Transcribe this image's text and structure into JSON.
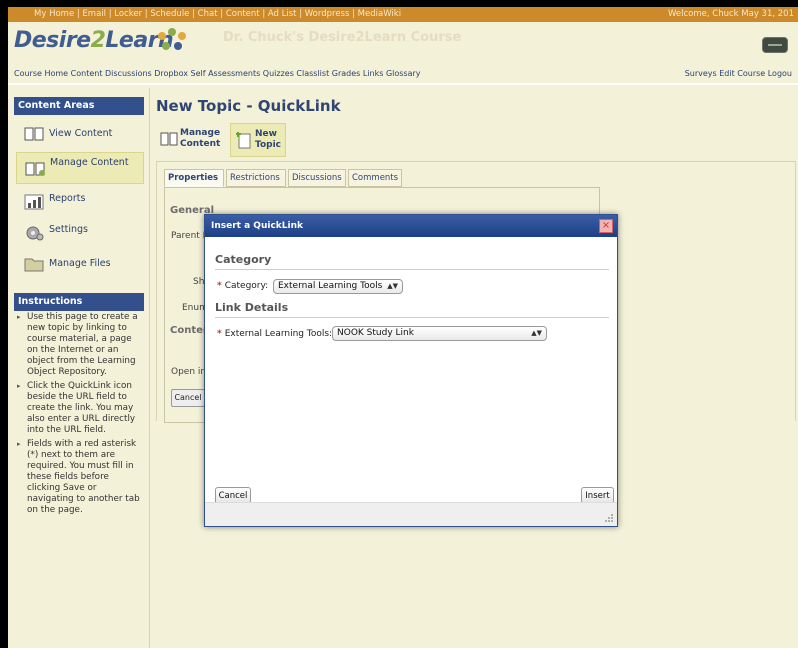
{
  "topbar": {
    "nav": "My Home | Email | Locker | Schedule | Chat | Content | Ad List | Wordpress | MediaWiki",
    "welcome": "Welcome, Chuck  May 31, 201"
  },
  "header": {
    "logo_main": "Desire",
    "logo_two": "2",
    "logo_end": "Learn",
    "course_title": "Dr. Chuck's Desire2Learn Course",
    "course_nav": "Course Home  Content  Discussions  Dropbox  Self Assessments  Quizzes  Classlist  Grades  Links  Glossary",
    "right_nav": "Surveys  Edit Course  Logou"
  },
  "sidebar": {
    "content_areas_title": "Content Areas",
    "items": [
      {
        "label": "View Content",
        "icon": "book-icon"
      },
      {
        "label": "Manage Content",
        "icon": "manage-book-icon"
      },
      {
        "label": "Reports",
        "icon": "chart-icon"
      },
      {
        "label": "Settings",
        "icon": "gear-icon"
      },
      {
        "label": "Manage Files",
        "icon": "folder-icon"
      }
    ],
    "instructions_title": "Instructions",
    "instructions": [
      "Use this page to create a new topic by linking to course material, a page on the Internet or an object from the Learning Object Repository.",
      "Click the QuickLink icon beside the URL field to create the link. You may also enter a URL directly into the URL field.",
      "Fields with a red asterisk (*) next to them are required. You must fill in these fields before clicking Save or navigating to another tab on the page."
    ]
  },
  "main": {
    "title": "New Topic - QuickLink",
    "toolbar": {
      "manage_line1": "Manage",
      "manage_line2": "Content",
      "new_line1": "New",
      "new_line2": "Topic"
    },
    "tabs": [
      "Properties",
      "Restrictions",
      "Discussions",
      "Comments"
    ],
    "background": {
      "general": "General",
      "parent": "Parent M",
      "sho": "Sho",
      "enume": "Enume",
      "conten": "Conten",
      "open_in": "Open in",
      "cancel": "Cancel"
    }
  },
  "modal": {
    "title": "Insert a QuickLink",
    "close": "×",
    "category_heading": "Category",
    "category_label": "Category:",
    "category_value": "External Learning Tools",
    "link_details_heading": "Link Details",
    "ext_tools_label": "External Learning Tools:",
    "ext_tools_value": "NOOK Study Link",
    "required_mark": "*",
    "cancel_label": "Cancel",
    "insert_label": "Insert"
  },
  "colors": {
    "topbar": "#cd8a2a",
    "page_bg": "#f3f1d8",
    "brand_blue": "#33508c",
    "modal_title": "#1d3f86"
  }
}
